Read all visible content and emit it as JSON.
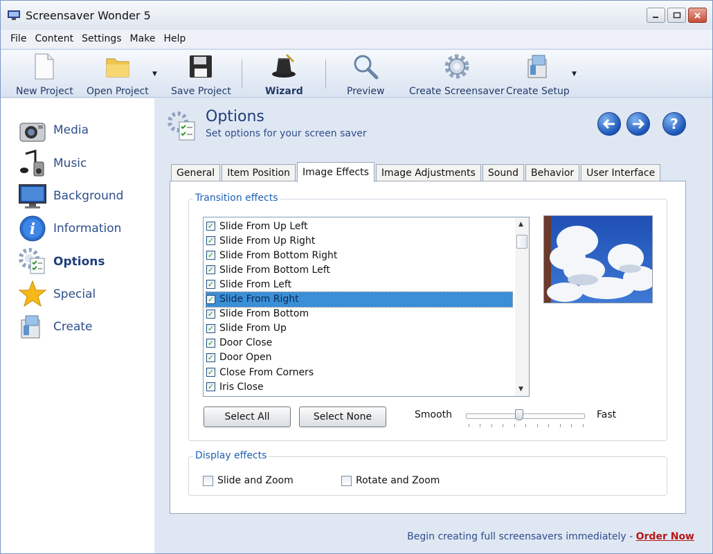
{
  "window": {
    "title": "Screensaver Wonder 5"
  },
  "menu": [
    "File",
    "Content",
    "Settings",
    "Make",
    "Help"
  ],
  "toolbar": {
    "new_project": "New Project",
    "open_project": "Open Project",
    "save_project": "Save Project",
    "wizard": "Wizard",
    "preview": "Preview",
    "create_screensaver": "Create Screensaver",
    "create_setup": "Create Setup"
  },
  "sidebar": {
    "items": [
      {
        "label": "Media",
        "icon": "camera-icon"
      },
      {
        "label": "Music",
        "icon": "music-icon"
      },
      {
        "label": "Background",
        "icon": "monitor-icon"
      },
      {
        "label": "Information",
        "icon": "info-icon"
      },
      {
        "label": "Options",
        "icon": "options-gear-icon",
        "active": true
      },
      {
        "label": "Special",
        "icon": "star-icon"
      },
      {
        "label": "Create",
        "icon": "create-icon"
      }
    ]
  },
  "options": {
    "title": "Options",
    "subtitle": "Set options for your screen saver"
  },
  "tabs": [
    "General",
    "Item Position",
    "Image Effects",
    "Image Adjustments",
    "Sound",
    "Behavior",
    "User Interface"
  ],
  "active_tab": "Image Effects",
  "transition": {
    "legend": "Transition effects",
    "items": [
      {
        "label": "Slide From Up Left",
        "checked": true
      },
      {
        "label": "Slide From Up Right",
        "checked": true
      },
      {
        "label": "Slide From Bottom Right",
        "checked": true
      },
      {
        "label": "Slide From Bottom Left",
        "checked": true
      },
      {
        "label": "Slide From Left",
        "checked": true
      },
      {
        "label": "Slide From Right",
        "checked": true,
        "selected": true
      },
      {
        "label": "Slide From Bottom",
        "checked": true
      },
      {
        "label": "Slide From Up",
        "checked": true
      },
      {
        "label": "Door Close",
        "checked": true
      },
      {
        "label": "Door Open",
        "checked": true
      },
      {
        "label": "Close From Corners",
        "checked": true
      },
      {
        "label": "Iris Close",
        "checked": true
      }
    ],
    "select_all": "Select All",
    "select_none": "Select None",
    "speed_min_label": "Smooth",
    "speed_max_label": "Fast",
    "speed_value": 0.45
  },
  "display": {
    "legend": "Display effects",
    "slide_zoom": {
      "label": "Slide and Zoom",
      "checked": false
    },
    "rotate_zoom": {
      "label": "Rotate and Zoom",
      "checked": false
    }
  },
  "footer": {
    "text": "Begin creating full screensavers immediately - ",
    "link": "Order Now"
  },
  "colors": {
    "accent": "#1e3f7a",
    "selection": "#3a8fd6",
    "link": "#b31616"
  }
}
